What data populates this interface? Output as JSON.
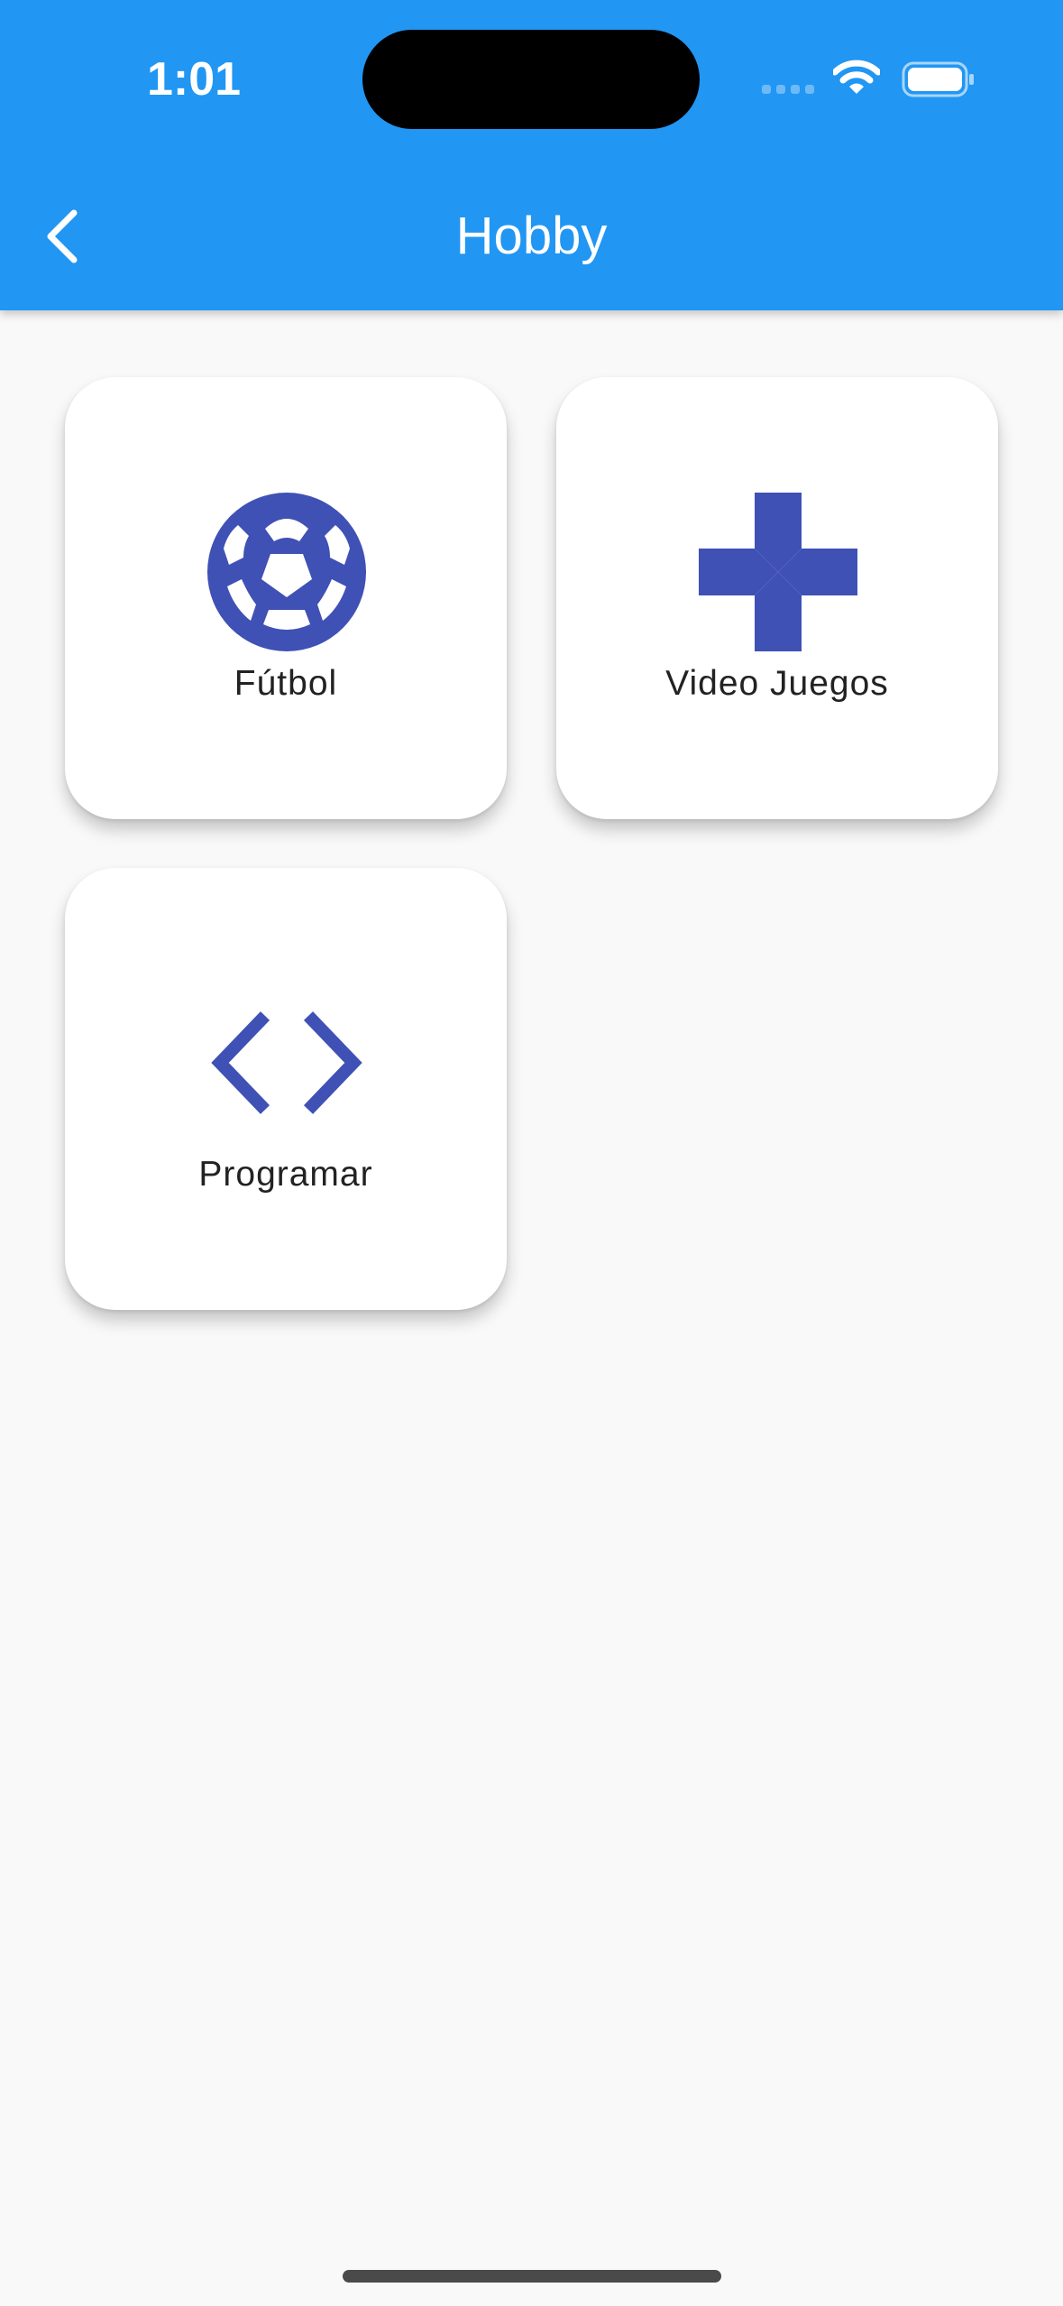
{
  "status_bar": {
    "time": "1:01",
    "signal_icon": "cellular-signal-icon",
    "wifi_icon": "wifi-icon",
    "battery_icon": "battery-icon"
  },
  "app_bar": {
    "title": "Hobby",
    "back_icon": "chevron-left-icon",
    "background_color": "#2196f3"
  },
  "hobbies": [
    {
      "label": "Fútbol",
      "icon": "soccer-ball-icon"
    },
    {
      "label": "Video Juegos",
      "icon": "gamepad-icon"
    },
    {
      "label": "Programar",
      "icon": "code-icon"
    }
  ],
  "colors": {
    "accent": "#3f51b5",
    "background": "#f9f9f9",
    "card": "#ffffff"
  }
}
